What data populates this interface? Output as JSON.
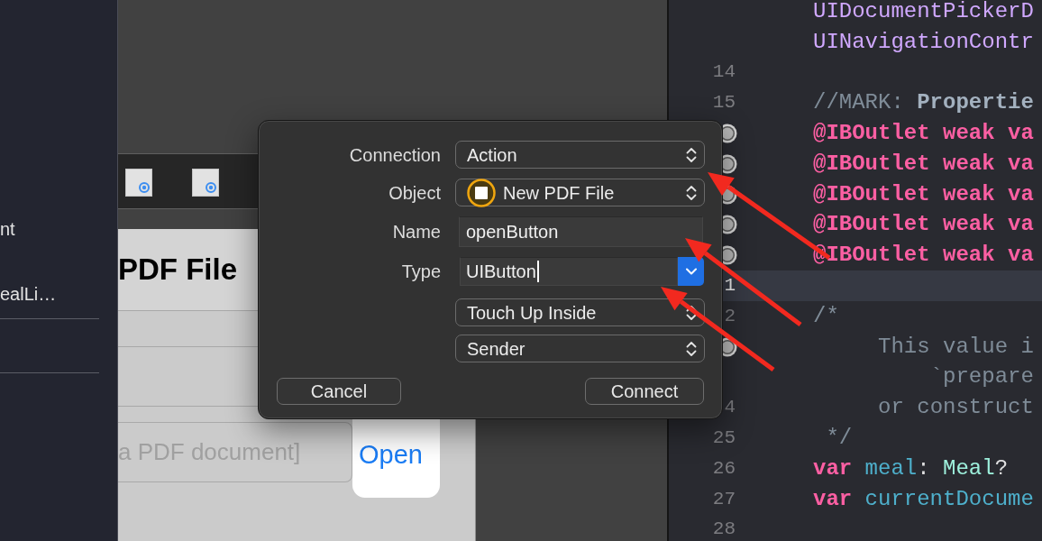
{
  "sidebar": {
    "items": [
      {
        "label": "nt"
      },
      {
        "label": "ealLi…"
      }
    ]
  },
  "storyboard": {
    "scene": {
      "title": "PDF File",
      "document_field": {
        "placeholder": "a PDF document]"
      },
      "open_button": {
        "label": "Open"
      }
    }
  },
  "dialog": {
    "rows": [
      {
        "kind": "popup",
        "label": "Connection",
        "value": "Action"
      },
      {
        "kind": "object",
        "label": "Object",
        "value": "New PDF File"
      },
      {
        "kind": "text",
        "label": "Name",
        "value": "openButton",
        "focused": false
      },
      {
        "kind": "combo",
        "label": "Type",
        "value": "UIButton",
        "focused": true
      },
      {
        "kind": "popup",
        "value": "Touch Up Inside"
      },
      {
        "kind": "popup",
        "value": "Sender"
      }
    ],
    "buttons": [
      {
        "label": "Cancel"
      },
      {
        "label": "Connect"
      }
    ]
  },
  "code_editor": {
    "lines": [
      {
        "outlet": false,
        "current": false,
        "tokens": [
          {
            "kind": "type",
            "text": "UIDocumentPickerD"
          }
        ]
      },
      {
        "outlet": false,
        "current": false,
        "tokens": [
          {
            "kind": "type",
            "text": "UINavigationContr"
          }
        ]
      },
      {
        "number": "14",
        "outlet": false,
        "current": false
      },
      {
        "number": "15",
        "outlet": false,
        "current": false,
        "tokens": [
          {
            "kind": "comment",
            "text": "//MARK: "
          },
          {
            "kind": "mark",
            "text": "Propertie"
          }
        ]
      },
      {
        "outlet": true,
        "current": false,
        "tokens": [
          {
            "kind": "keyword",
            "text": "@IBOutlet weak va"
          }
        ]
      },
      {
        "outlet": true,
        "current": false,
        "tokens": [
          {
            "kind": "keyword",
            "text": "@IBOutlet weak va"
          }
        ]
      },
      {
        "outlet": true,
        "current": false,
        "tokens": [
          {
            "kind": "keyword",
            "text": "@IBOutlet weak va"
          }
        ]
      },
      {
        "outlet": true,
        "current": false,
        "tokens": [
          {
            "kind": "keyword",
            "text": "@IBOutlet weak va"
          }
        ]
      },
      {
        "outlet": true,
        "current": false,
        "tokens": [
          {
            "kind": "keyword",
            "text": "@IBOutlet weak va"
          }
        ]
      },
      {
        "number": "1",
        "outlet": false,
        "current": true
      },
      {
        "number": "2",
        "outlet": false,
        "current": false,
        "tokens": [
          {
            "kind": "comment",
            "text": "/*"
          }
        ]
      },
      {
        "outlet": true,
        "current": false,
        "tokens": [
          {
            "kind": "comment",
            "text": "     This value i"
          }
        ]
      },
      {
        "outlet": false,
        "current": false,
        "tokens": [
          {
            "kind": "comment",
            "text": "         `prepare"
          }
        ]
      },
      {
        "number": "4",
        "outlet": false,
        "current": false,
        "tokens": [
          {
            "kind": "comment",
            "text": "     or construct"
          }
        ]
      },
      {
        "number": "25",
        "outlet": false,
        "current": false,
        "tokens": [
          {
            "kind": "comment",
            "text": " */"
          }
        ]
      },
      {
        "number": "26",
        "outlet": false,
        "current": false,
        "tokens": [
          {
            "kind": "keyword",
            "text": "var "
          },
          {
            "kind": "variable",
            "text": "meal"
          },
          {
            "kind": "plain",
            "text": ": "
          },
          {
            "kind": "project_type",
            "text": "Meal"
          },
          {
            "kind": "plain",
            "text": "?"
          }
        ]
      },
      {
        "number": "27",
        "outlet": false,
        "current": false,
        "tokens": [
          {
            "kind": "keyword",
            "text": "var "
          },
          {
            "kind": "variable",
            "text": "currentDocume"
          }
        ]
      },
      {
        "number": "28",
        "outlet": false,
        "current": false
      }
    ]
  }
}
